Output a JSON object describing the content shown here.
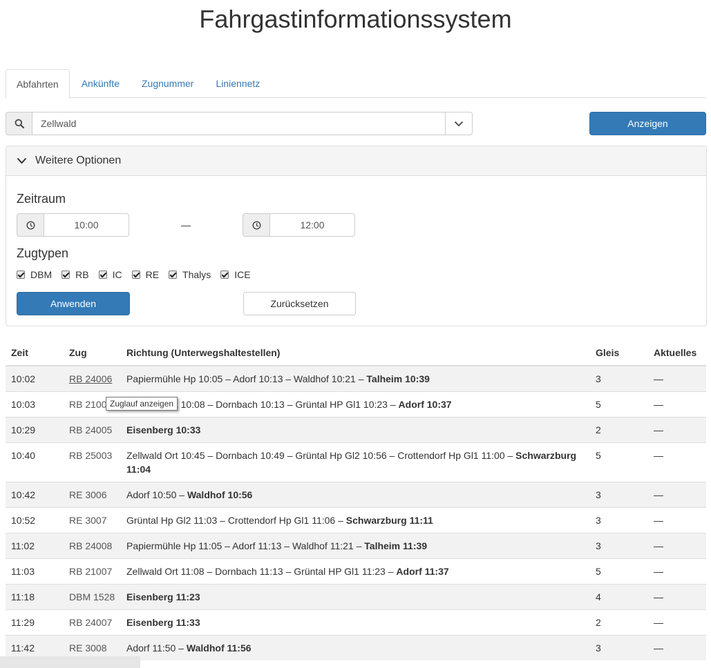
{
  "page": {
    "title": "Fahrgastinformationssystem"
  },
  "tabs": [
    {
      "label": "Abfahrten",
      "active": true
    },
    {
      "label": "Ankünfte",
      "active": false
    },
    {
      "label": "Zugnummer",
      "active": false
    },
    {
      "label": "Liniennetz",
      "active": false
    }
  ],
  "search": {
    "value": "Zellwald",
    "show_button": "Anzeigen"
  },
  "options": {
    "heading": "Weitere Optionen",
    "period_label": "Zeitraum",
    "time_from": "10:00",
    "time_separator": "—",
    "time_to": "12:00",
    "train_types_label": "Zugtypen",
    "train_types": [
      {
        "label": "DBM",
        "checked": true
      },
      {
        "label": "RB",
        "checked": true
      },
      {
        "label": "IC",
        "checked": true
      },
      {
        "label": "RE",
        "checked": true
      },
      {
        "label": "Thalys",
        "checked": true
      },
      {
        "label": "ICE",
        "checked": true
      }
    ],
    "apply_button": "Anwenden",
    "reset_button": "Zurücksetzen"
  },
  "table": {
    "headers": {
      "time": "Zeit",
      "train": "Zug",
      "direction": "Richtung (Unterwegshaltestellen)",
      "track": "Gleis",
      "news": "Aktuelles"
    },
    "rows": [
      {
        "time": "10:02",
        "train": "RB 24006",
        "stops": "Papiermühle Hp 10:05 – Adorf 10:13 – Waldhof 10:21 – ",
        "dest": "Talheim 10:39",
        "track": "3",
        "news": "—"
      },
      {
        "time": "10:03",
        "train": "RB 21005",
        "stops": "Zellwald Ort 10:08 – Dornbach 10:13 – Grüntal HP Gl1 10:23 – ",
        "dest": "Adorf 10:37",
        "track": "5",
        "news": "—"
      },
      {
        "time": "10:29",
        "train": "RB 24005",
        "stops": "",
        "dest": "Eisenberg 10:33",
        "track": "2",
        "news": "—"
      },
      {
        "time": "10:40",
        "train": "RB 25003",
        "stops": "Zellwald Ort 10:45 – Dornbach 10:49 – Grüntal Hp Gl2 10:56 – Crottendorf Hp Gl1 11:00 – ",
        "dest": "Schwarzburg 11:04",
        "track": "5",
        "news": "—"
      },
      {
        "time": "10:42",
        "train": "RE 3006",
        "stops": "Adorf 10:50 – ",
        "dest": "Waldhof 10:56",
        "track": "3",
        "news": "—"
      },
      {
        "time": "10:52",
        "train": "RE 3007",
        "stops": "Grüntal Hp Gl2 11:03 – Crottendorf Hp Gl1 11:06 – ",
        "dest": "Schwarzburg 11:11",
        "track": "3",
        "news": "—"
      },
      {
        "time": "11:02",
        "train": "RB 24008",
        "stops": "Papiermühle Hp 11:05 – Adorf 11:13 – Waldhof 11:21 – ",
        "dest": "Talheim 11:39",
        "track": "3",
        "news": "—"
      },
      {
        "time": "11:03",
        "train": "RB 21007",
        "stops": "Zellwald Ort 11:08 – Dornbach 11:13 – Grüntal HP Gl1 11:23 – ",
        "dest": "Adorf 11:37",
        "track": "5",
        "news": "—"
      },
      {
        "time": "11:18",
        "train": "DBM 1528",
        "stops": "",
        "dest": "Eisenberg 11:23",
        "track": "4",
        "news": "—"
      },
      {
        "time": "11:29",
        "train": "RB 24007",
        "stops": "",
        "dest": "Eisenberg 11:33",
        "track": "2",
        "news": "—"
      },
      {
        "time": "11:42",
        "train": "RE 3008",
        "stops": "Adorf 11:50 – ",
        "dest": "Waldhof 11:56",
        "track": "3",
        "news": "—"
      }
    ]
  },
  "tooltip": {
    "text": "Zuglauf anzeigen"
  }
}
